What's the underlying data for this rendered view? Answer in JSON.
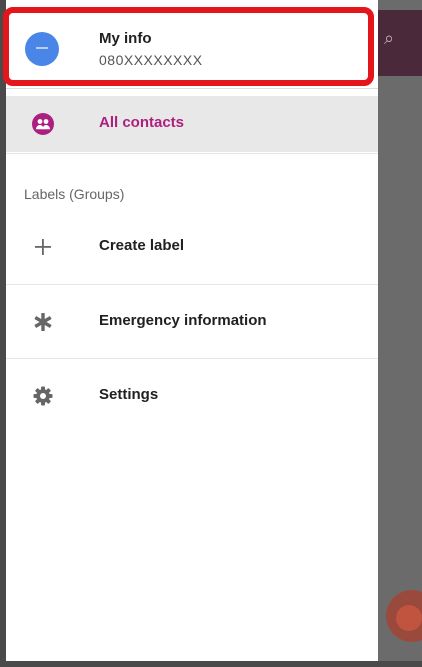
{
  "profile": {
    "name": "My info",
    "phone": "080XXXXXXXX"
  },
  "nav": {
    "all_contacts": {
      "label": "All contacts",
      "icon": "group-icon"
    }
  },
  "labels_section": {
    "title": "Labels (Groups)",
    "create_label": {
      "label": "Create label",
      "icon": "plus-icon"
    }
  },
  "extras": [
    {
      "label": "Emergency information",
      "icon": "asterisk-icon"
    },
    {
      "label": "Settings",
      "icon": "gear-icon"
    }
  ],
  "colors": {
    "accent": "#ad1f7f",
    "avatar": "#4a86e8",
    "highlight_border": "#e4151b",
    "selected_bg": "#e8e8e8"
  }
}
